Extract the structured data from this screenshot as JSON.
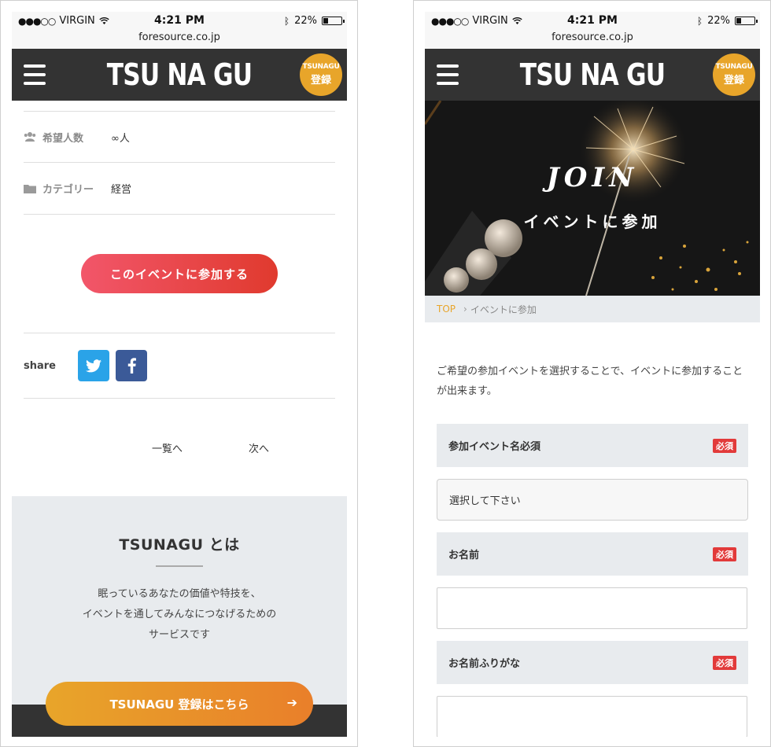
{
  "status": {
    "carrier": "VIRGIN",
    "signal": "●●●○○",
    "time": "4:21 PM",
    "battery": "22%"
  },
  "url": "foresource.co.jp",
  "header": {
    "brand": "TSU NA GU",
    "badge_top": "TSUNAGU",
    "badge_bottom": "登録"
  },
  "event_detail": {
    "rows": [
      {
        "label": "希望人数",
        "value": "∞人",
        "icon": "people-icon"
      },
      {
        "label": "カテゴリー",
        "value": "経営",
        "icon": "folder-icon"
      }
    ],
    "join_button": "このイベントに参加する",
    "share_label": "share",
    "pager": {
      "prev": "一覧へ",
      "next": "次へ"
    }
  },
  "about": {
    "title": "TSUNAGU とは",
    "lines": [
      "眠っているあなたの価値や特技を、",
      "イベントを通してみんなにつなげるための",
      "サービスです"
    ],
    "signup_button": "TSUNAGU 登録はこちら",
    "signup_arrow": "➔"
  },
  "join_page": {
    "hero_title": "JOIN",
    "hero_subtitle": "イベントに参加",
    "breadcrumb": {
      "top": "TOP",
      "separator": "›",
      "current": "イベントに参加"
    },
    "lead": "ご希望の参加イベントを選択することで、イベントに参加することが出来ます。",
    "fields": [
      {
        "label": "参加イベント名必須",
        "badge": "必須",
        "placeholder": "選択して下さい"
      },
      {
        "label": "お名前",
        "badge": "必須"
      },
      {
        "label": "お名前ふりがな",
        "badge": "必須"
      }
    ]
  },
  "colors": {
    "header": "#333333",
    "accent_orange": "#e8a52a",
    "join_red": "#e03a2e",
    "required_red": "#e23a3a",
    "twitter": "#2aa3e8",
    "facebook": "#3b5a98"
  }
}
